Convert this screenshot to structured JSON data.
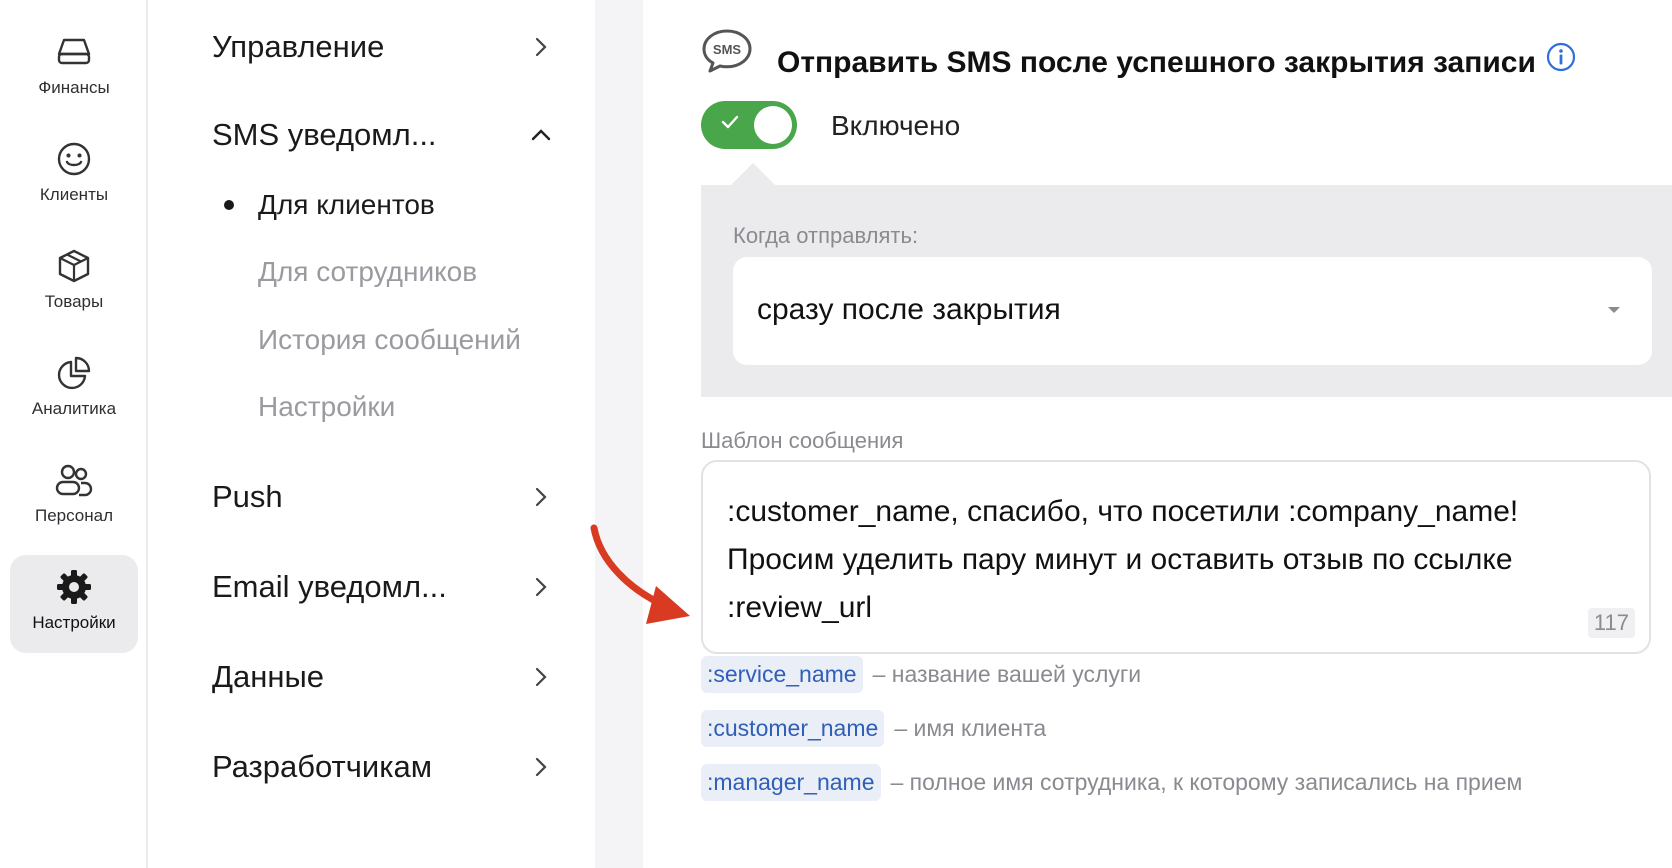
{
  "rail": {
    "items": [
      {
        "label": "Финансы",
        "icon": "wallet-icon"
      },
      {
        "label": "Клиенты",
        "icon": "smile-icon"
      },
      {
        "label": "Товары",
        "icon": "box-icon"
      },
      {
        "label": "Аналитика",
        "icon": "pie-chart-icon"
      },
      {
        "label": "Персонал",
        "icon": "people-icon"
      },
      {
        "label": "Настройки",
        "icon": "gear-icon",
        "active": true
      }
    ]
  },
  "menu": {
    "items": [
      {
        "label": "Управление"
      },
      {
        "label": "SMS уведомл...",
        "expanded": true
      },
      {
        "label": "Push"
      },
      {
        "label": "Email уведомл..."
      },
      {
        "label": "Данные"
      },
      {
        "label": "Разработчикам"
      }
    ],
    "sms_sub": [
      {
        "label": "Для клиентов",
        "active": true
      },
      {
        "label": "Для сотрудников"
      },
      {
        "label": "История сообщений"
      },
      {
        "label": "Настройки"
      }
    ]
  },
  "main": {
    "title": "Отправить SMS после успешного закрытия записи",
    "sms_badge": "SMS",
    "toggle": {
      "on": true,
      "label": "Включено"
    },
    "when": {
      "label": "Когда отправлять:",
      "value": "сразу после закрытия"
    },
    "template": {
      "label": "Шаблон сообщения",
      "text": ":customer_name, спасибо, что посетили :company_name!\nПросим уделить пару минут и оставить отзыв по ссылке\n:review_url",
      "counter": "117"
    },
    "variables": [
      {
        "tag": ":service_name",
        "desc": "– название вашей услуги"
      },
      {
        "tag": ":customer_name",
        "desc": "– имя клиента"
      },
      {
        "tag": ":manager_name",
        "desc": "– полное имя сотрудника, к которому записались на прием"
      }
    ]
  },
  "colors": {
    "toggle_on": "#4aa64a",
    "accent_blue": "#2f5fb8",
    "annotation_arrow": "#d83a22"
  }
}
